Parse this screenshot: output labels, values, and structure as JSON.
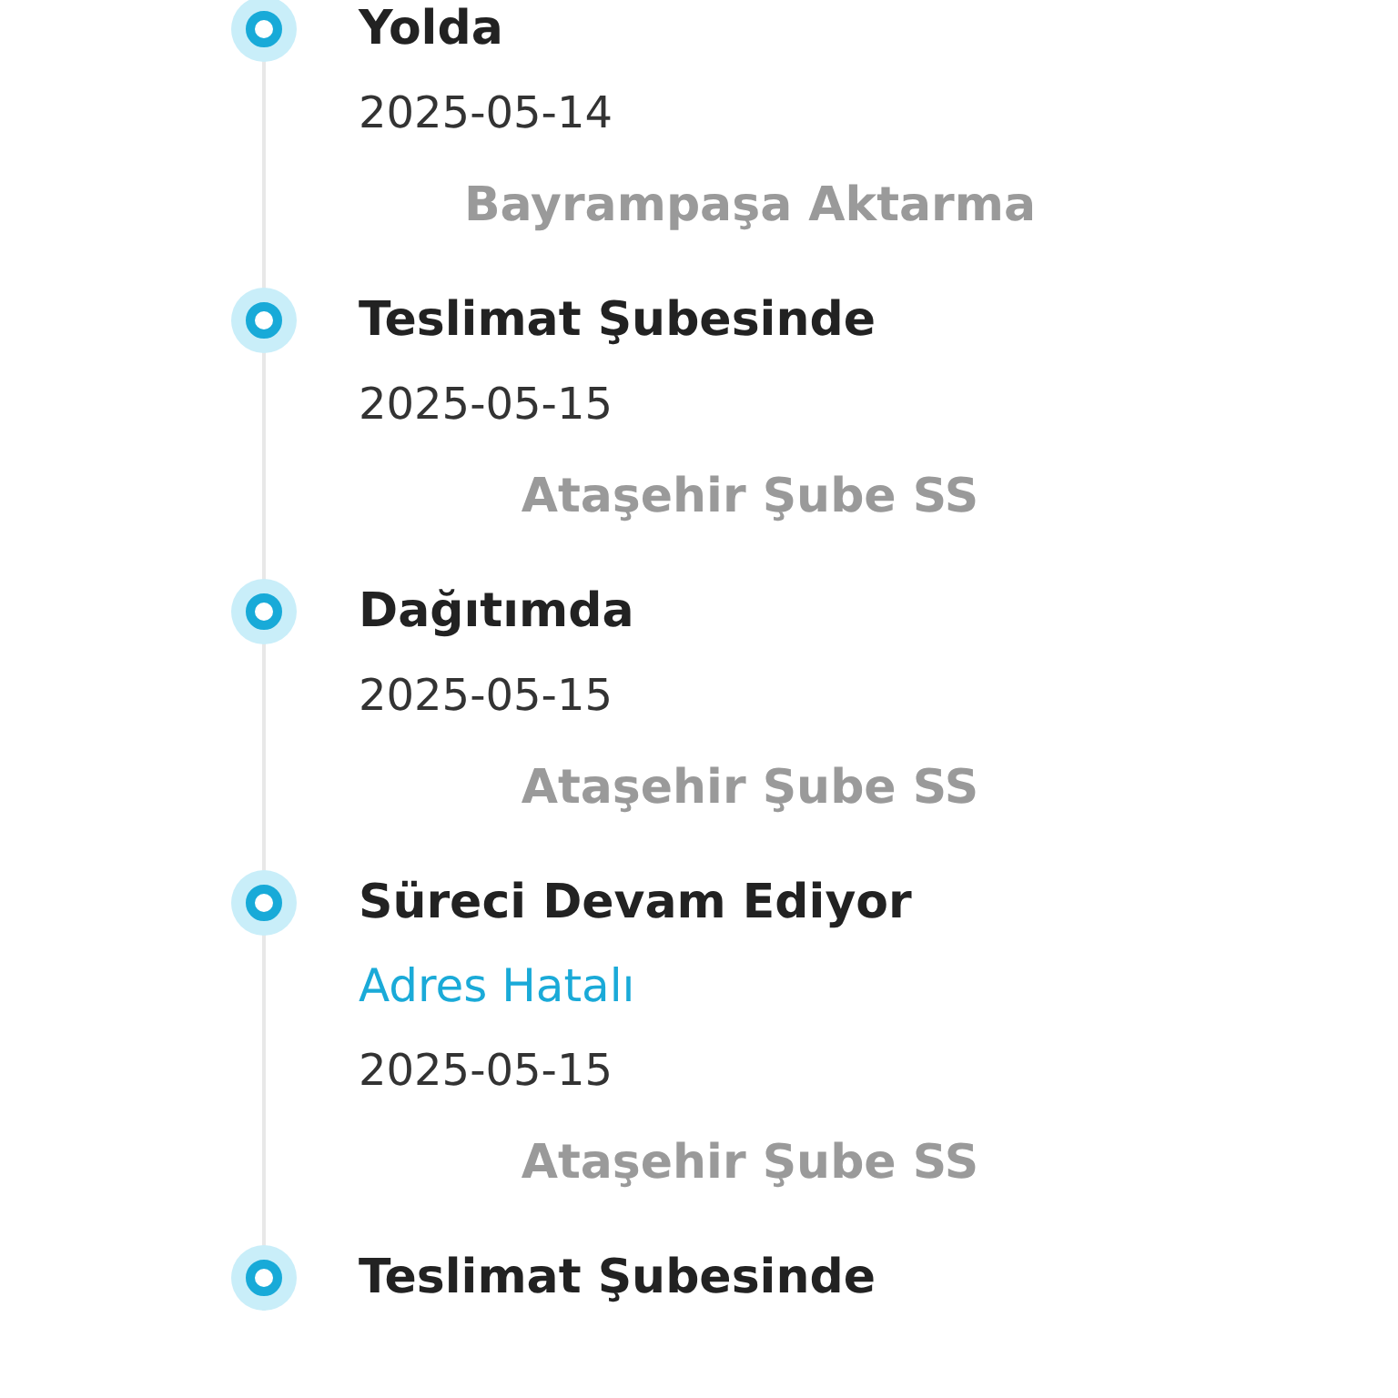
{
  "timeline": [
    {
      "title": "Yolda",
      "date": "2025-05-14",
      "location": "Bayrampaşa Aktarma"
    },
    {
      "title": "Teslimat Şubesinde",
      "date": "2025-05-15",
      "location": "Ataşehir Şube SS"
    },
    {
      "title": "Dağıtımda",
      "date": "2025-05-15",
      "location": "Ataşehir Şube SS"
    },
    {
      "title": "Süreci Devam Ediyor",
      "note": "Adres Hatalı",
      "date": "2025-05-15",
      "location": "Ataşehir Şube SS"
    },
    {
      "title": "Teslimat Şubesinde"
    }
  ]
}
